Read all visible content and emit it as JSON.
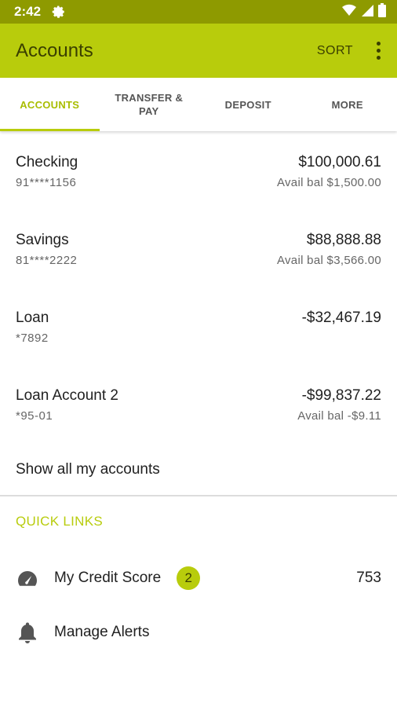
{
  "status": {
    "time": "2:42"
  },
  "app_bar": {
    "title": "Accounts",
    "sort_label": "SORT"
  },
  "tabs": [
    {
      "label": "ACCOUNTS",
      "active": true
    },
    {
      "label": "TRANSFER & PAY",
      "active": false
    },
    {
      "label": "DEPOSIT",
      "active": false
    },
    {
      "label": "MORE",
      "active": false
    }
  ],
  "accounts": [
    {
      "name": "Checking",
      "number": "91****1156",
      "balance": "$100,000.61",
      "avail": "Avail bal $1,500.00"
    },
    {
      "name": "Savings",
      "number": "81****2222",
      "balance": "$88,888.88",
      "avail": "Avail bal $3,566.00"
    },
    {
      "name": "Loan",
      "number": "*7892",
      "balance": "-$32,467.19",
      "avail": ""
    },
    {
      "name": "Loan Account 2",
      "number": "*95-01",
      "balance": "-$99,837.22",
      "avail": "Avail bal -$9.11"
    }
  ],
  "show_all": "Show all my accounts",
  "quick_links": {
    "heading": "QUICK LINKS",
    "credit_score": {
      "label": "My Credit Score",
      "badge": "2",
      "value": "753",
      "icon": "speedometer-icon"
    },
    "alerts": {
      "label": "Manage Alerts",
      "icon": "bell-icon"
    }
  },
  "colors": {
    "accent": "#b8cc0c",
    "status_bar": "#8e9a00",
    "accent_dark_text": "#3a3f00"
  }
}
